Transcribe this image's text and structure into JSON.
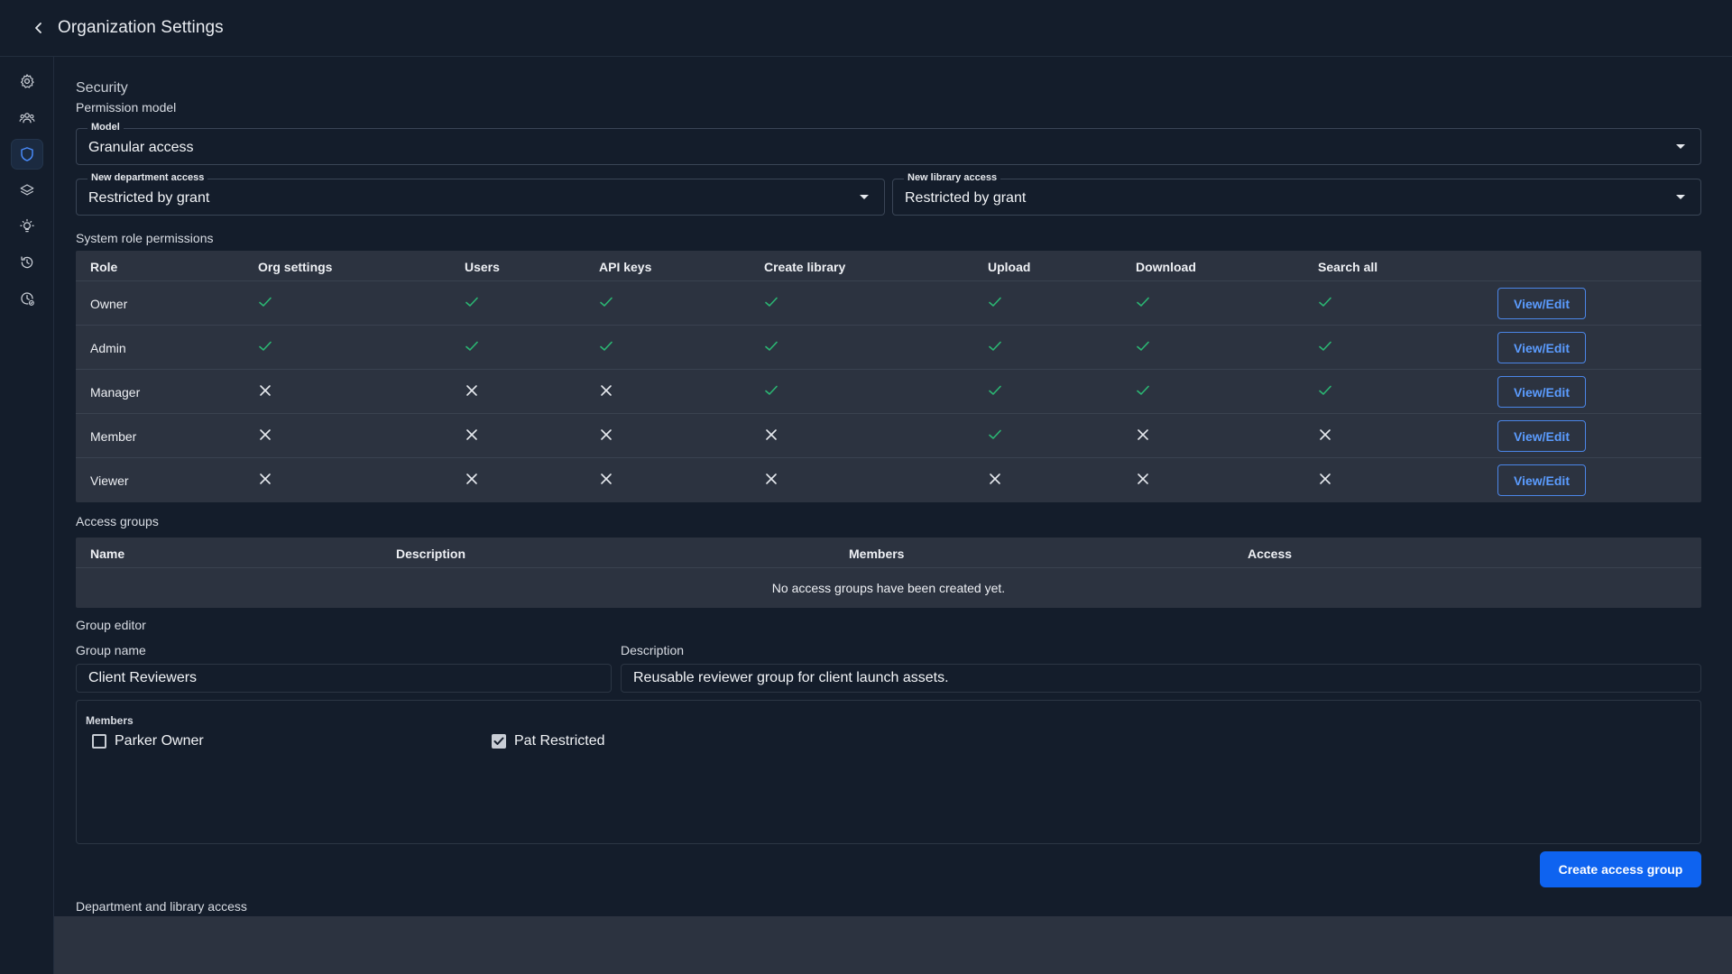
{
  "header": {
    "title": "Organization Settings"
  },
  "sidebar": {
    "items": [
      {
        "icon": "gear-icon",
        "active": false
      },
      {
        "icon": "users-icon",
        "active": false
      },
      {
        "icon": "shield-icon",
        "active": true
      },
      {
        "icon": "layers-icon",
        "active": false
      },
      {
        "icon": "lightbulb-icon",
        "active": false
      },
      {
        "icon": "history-icon",
        "active": false
      },
      {
        "icon": "clock-badge-icon",
        "active": false
      }
    ]
  },
  "security": {
    "title": "Security",
    "permission_model_label": "Permission model",
    "model": {
      "label": "Model",
      "value": "Granular access"
    },
    "new_department_access": {
      "label": "New department access",
      "value": "Restricted by grant"
    },
    "new_library_access": {
      "label": "New library access",
      "value": "Restricted by grant"
    }
  },
  "system_roles": {
    "title": "System role permissions",
    "columns": [
      "Role",
      "Org settings",
      "Users",
      "API keys",
      "Create library",
      "Upload",
      "Download",
      "Search all"
    ],
    "rows": [
      {
        "role": "Owner",
        "perms": [
          true,
          true,
          true,
          true,
          true,
          true,
          true
        ]
      },
      {
        "role": "Admin",
        "perms": [
          true,
          true,
          true,
          true,
          true,
          true,
          true
        ]
      },
      {
        "role": "Manager",
        "perms": [
          false,
          false,
          false,
          true,
          true,
          true,
          true
        ]
      },
      {
        "role": "Member",
        "perms": [
          false,
          false,
          false,
          false,
          true,
          false,
          false
        ]
      },
      {
        "role": "Viewer",
        "perms": [
          false,
          false,
          false,
          false,
          false,
          false,
          false
        ]
      }
    ],
    "action_label": "View/Edit",
    "colors": {
      "check": "#2bb673",
      "cross": "#e6e9ee"
    }
  },
  "access_groups": {
    "title": "Access groups",
    "columns": [
      "Name",
      "Description",
      "Members",
      "Access"
    ],
    "empty_text": "No access groups have been created yet."
  },
  "group_editor": {
    "title": "Group editor",
    "group_name_label": "Group name",
    "group_name_value": "Client Reviewers",
    "description_label": "Description",
    "description_value": "Reusable reviewer group for client launch assets.",
    "members_label": "Members",
    "members": [
      {
        "name": "Parker Owner",
        "checked": false
      },
      {
        "name": "Pat Restricted",
        "checked": true
      }
    ],
    "create_label": "Create access group"
  },
  "dept_library": {
    "title": "Department and library access"
  },
  "colors": {
    "accent": "#0e63f0",
    "link": "#5b9cff",
    "background": "#141d2b",
    "table_bg": "#2c3340"
  }
}
